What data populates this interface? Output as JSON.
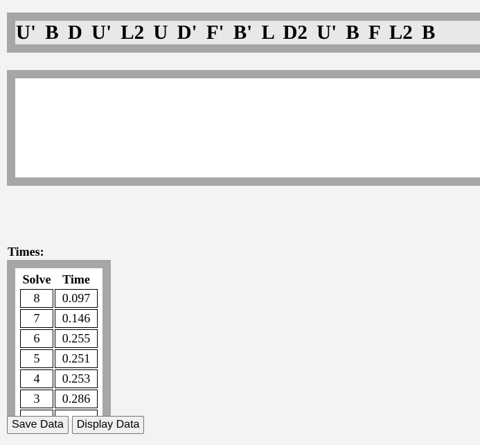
{
  "scramble": {
    "text": "U' B D U' L2 U D' F' B' L D2 U' B F L2 B"
  },
  "times": {
    "label": "Times:",
    "headers": {
      "solve": "Solve",
      "time": "Time"
    },
    "rows": [
      {
        "solve": "8",
        "time": "0.097"
      },
      {
        "solve": "7",
        "time": "0.146"
      },
      {
        "solve": "6",
        "time": "0.255"
      },
      {
        "solve": "5",
        "time": "0.251"
      },
      {
        "solve": "4",
        "time": "0.253"
      },
      {
        "solve": "3",
        "time": "0.286"
      }
    ]
  },
  "buttons": {
    "save": "Save Data",
    "display": "Display Data"
  }
}
